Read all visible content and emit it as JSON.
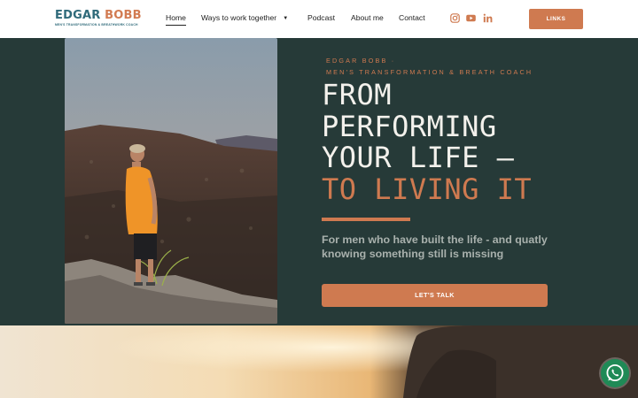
{
  "brand": {
    "name_part1": "EDGAR",
    "name_part2": "BOBB",
    "tagline": "MEN'S TRANSFORMATION & BREATHWORK COACH"
  },
  "nav": {
    "home": "Home",
    "ways": "Ways to work together",
    "podcast": "Podcast",
    "about": "About me",
    "contact": "Contact"
  },
  "social": [
    "instagram-icon",
    "youtube-icon",
    "linkedin-icon"
  ],
  "header": {
    "links_label": "LINKS"
  },
  "hero": {
    "eyebrow_line1": "EDGAR BOBB ·",
    "eyebrow_line2": "MEN'S TRANSFORMATION & BREATH COACH",
    "headline_line1": "FROM",
    "headline_line2": "PERFORMING",
    "headline_line3": "YOUR LIFE –",
    "headline_accent": "TO LIVING IT",
    "subline": "For men who have built the life - and quatly knowing something still is missing",
    "cta_label": "LET'S TALK"
  },
  "colors": {
    "accent": "#cf7a50",
    "hero_bg": "#263a38",
    "brand_teal": "#2f6a7a",
    "whatsapp": "#1f8a56"
  }
}
